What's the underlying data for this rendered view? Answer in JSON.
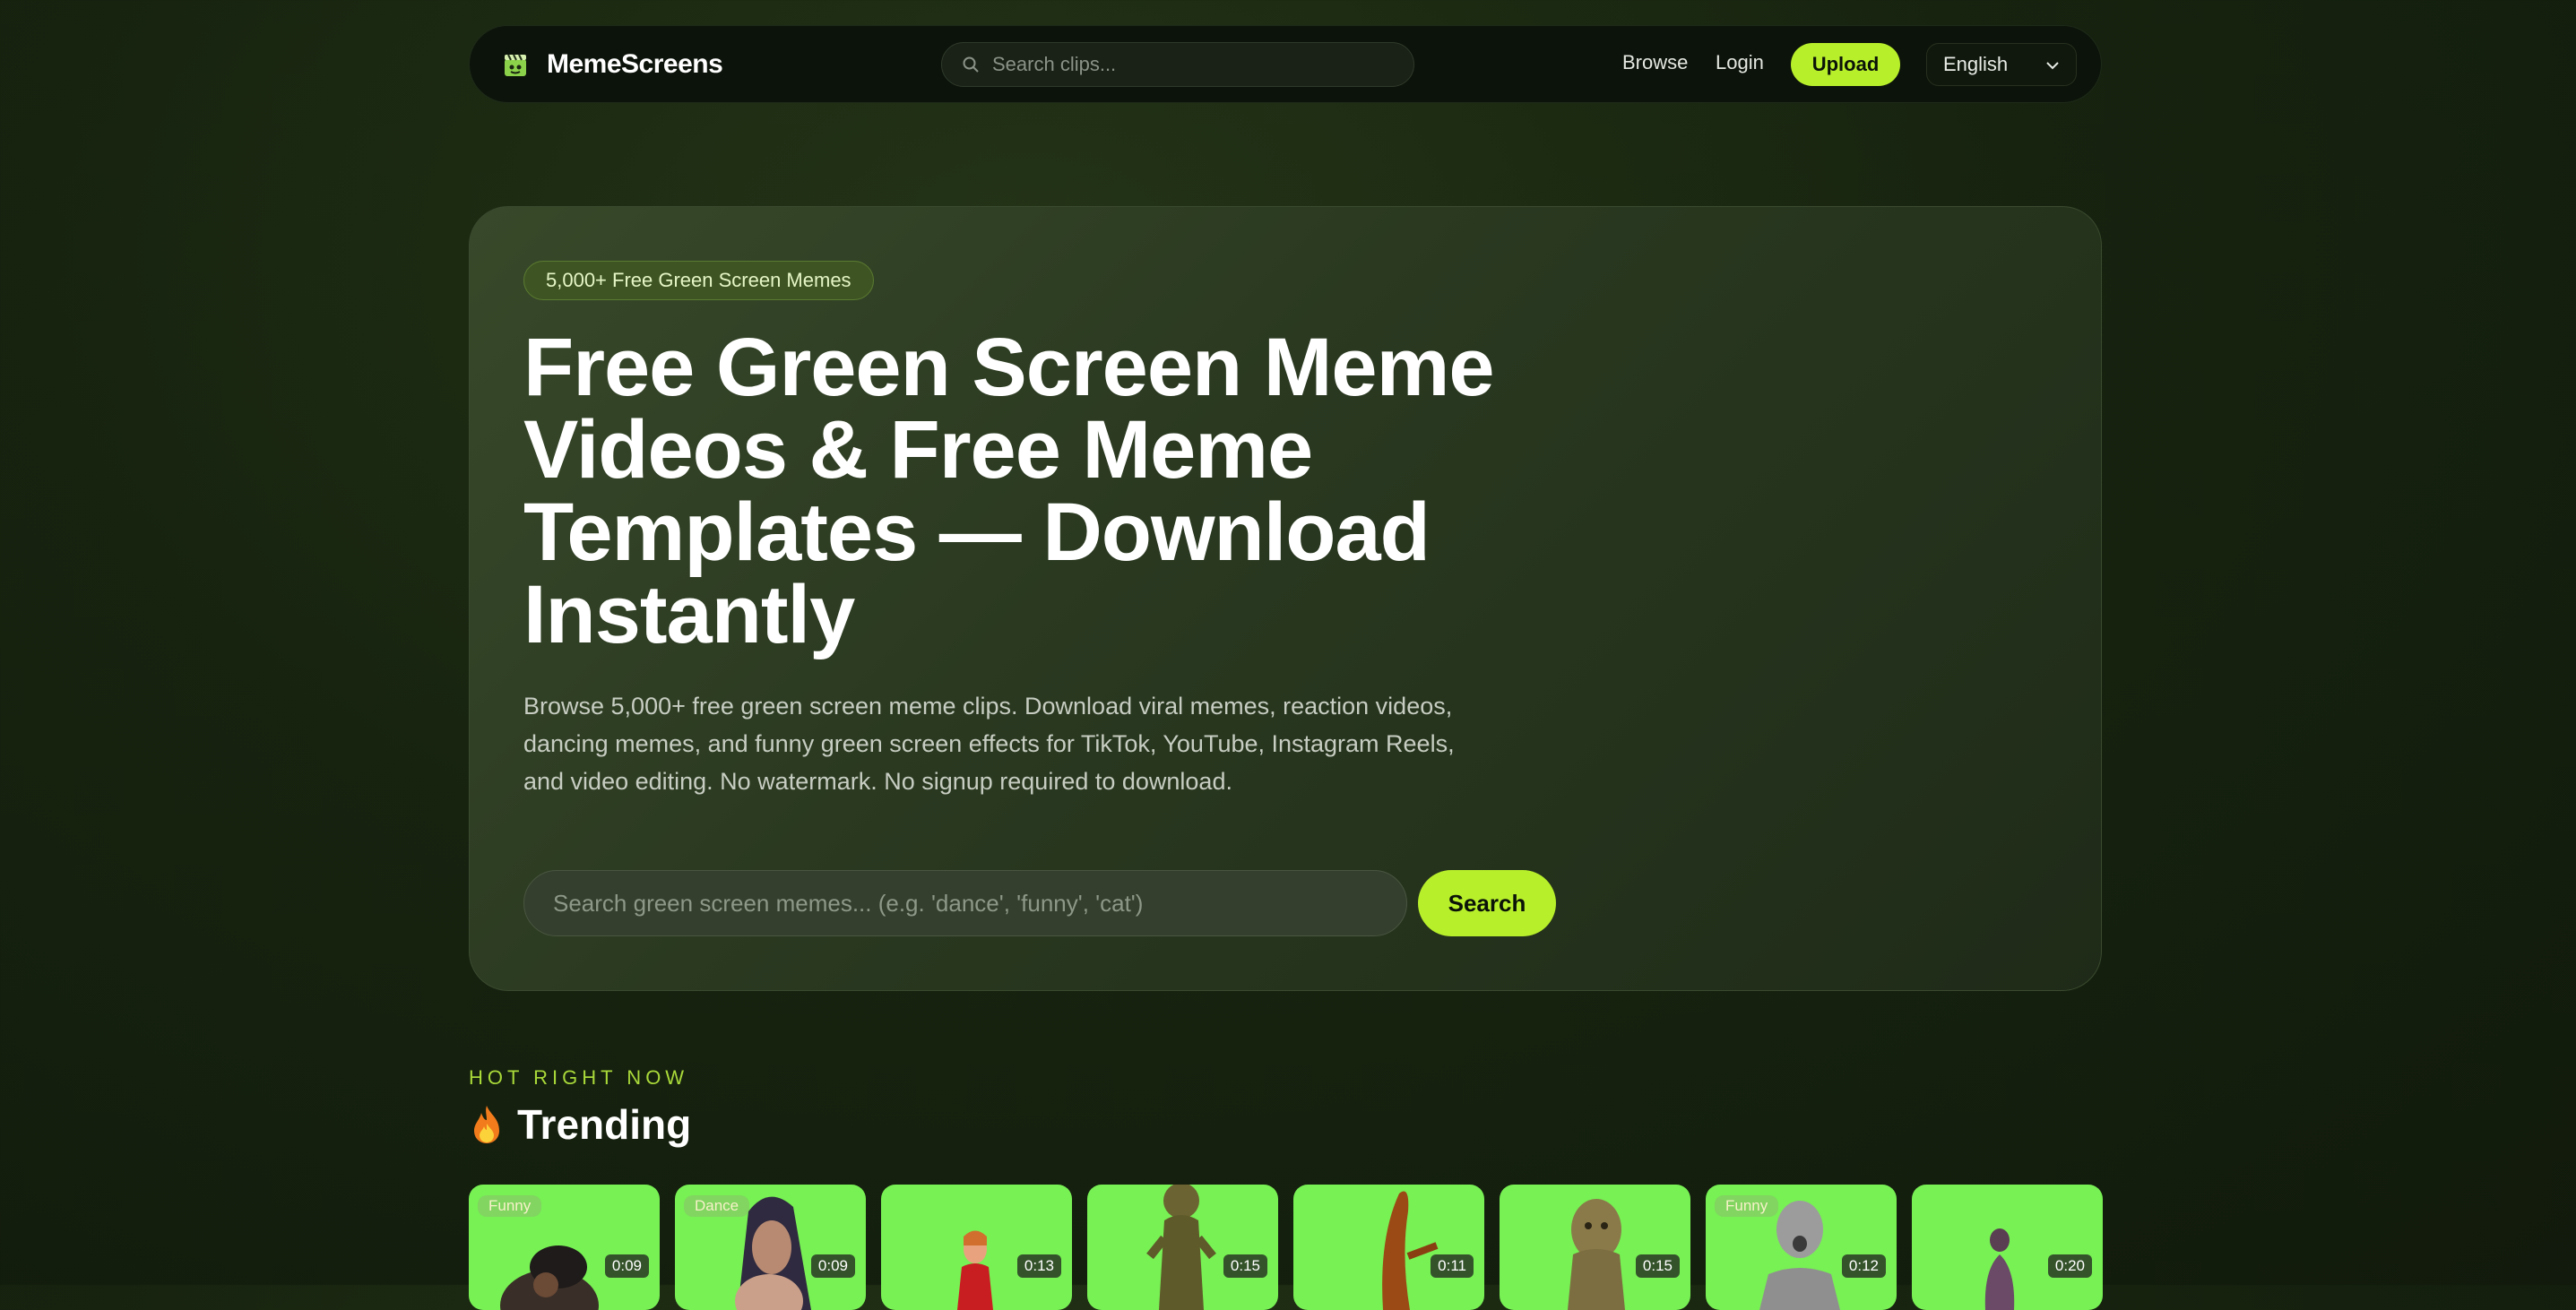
{
  "nav": {
    "brand": "MemeScreens",
    "search_placeholder": "Search clips...",
    "browse": "Browse",
    "login": "Login",
    "upload": "Upload",
    "language": "English"
  },
  "hero": {
    "badge": "5,000+ Free Green Screen Memes",
    "title": "Free Green Screen Meme Videos & Free Meme Templates — Download Instantly",
    "description": "Browse 5,000+ free green screen meme clips. Download viral memes, reaction videos, dancing memes, and funny green screen effects for TikTok, YouTube, Instagram Reels, and video editing. No watermark. No signup required to download.",
    "search_placeholder": "Search green screen memes... (e.g. 'dance', 'funny', 'cat')",
    "search_button": "Search"
  },
  "trending": {
    "eyebrow": "HOT RIGHT NOW",
    "title": "Trending",
    "cards": [
      {
        "tag": "Funny",
        "duration": "0:09"
      },
      {
        "tag": "Dance",
        "duration": "0:09"
      },
      {
        "tag": "",
        "duration": "0:13"
      },
      {
        "tag": "",
        "duration": "0:15"
      },
      {
        "tag": "",
        "duration": "0:11"
      },
      {
        "tag": "",
        "duration": "0:15"
      },
      {
        "tag": "Funny",
        "duration": "0:12"
      },
      {
        "tag": "",
        "duration": "0:20"
      }
    ]
  },
  "colors": {
    "accent": "#b7ef2b",
    "green_screen": "#77f154"
  }
}
